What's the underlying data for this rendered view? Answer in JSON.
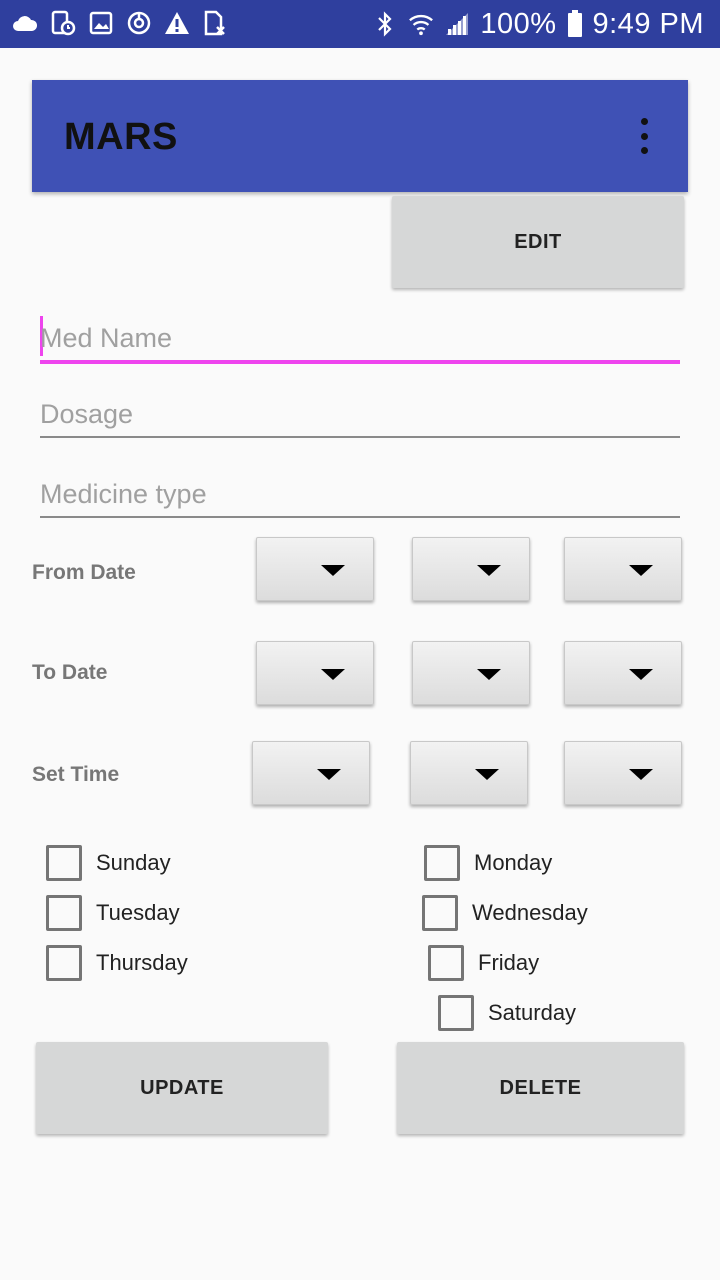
{
  "status_bar": {
    "battery": "100%",
    "time": "9:49 PM",
    "left_icons": [
      "cloud-icon",
      "phone-clock-icon",
      "image-icon",
      "sync-icon",
      "warning-icon",
      "sim-x-icon"
    ],
    "right_icons": [
      "bluetooth-icon",
      "wifi-icon",
      "signal-icon",
      "battery-icon"
    ]
  },
  "app_bar": {
    "title": "MARS",
    "menu_icon": "overflow-menu-icon"
  },
  "edit_button": "EDIT",
  "fields": {
    "med_name_placeholder": "Med Name",
    "dosage_placeholder": "Dosage",
    "medicine_type_placeholder": "Medicine type"
  },
  "rows": {
    "from_date": "From Date",
    "to_date": "To Date",
    "set_time": "Set Time"
  },
  "days": {
    "sunday": "Sunday",
    "monday": "Monday",
    "tuesday": "Tuesday",
    "wednesday": "Wednesday",
    "thursday": "Thursday",
    "friday": "Friday",
    "saturday": "Saturday"
  },
  "actions": {
    "update": "UPDATE",
    "delete": "DELETE"
  },
  "colors": {
    "status_bar": "#2f3f9e",
    "app_bar": "#3f51b5",
    "accent": "#ee44ee"
  }
}
